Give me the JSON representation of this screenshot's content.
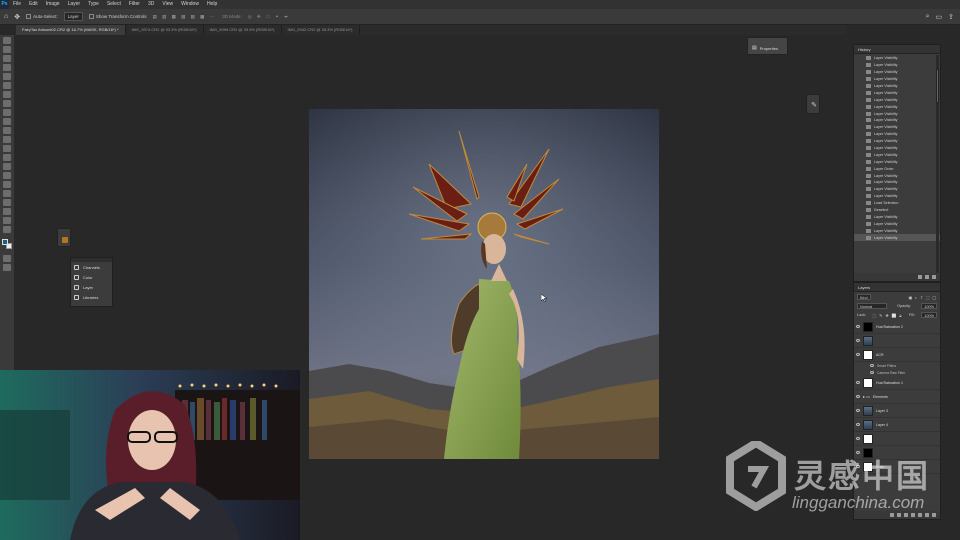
{
  "menubar": {
    "items": [
      "File",
      "Edit",
      "Image",
      "Layer",
      "Type",
      "Select",
      "Filter",
      "3D",
      "View",
      "Window",
      "Help"
    ]
  },
  "options": {
    "auto_select_label": "Auto-Select:",
    "auto_select_value": "Layer",
    "show_transform_label": "Show Transform Controls",
    "mode_3d_label": "3D Mode:"
  },
  "tabs": [
    {
      "label": "FairyTaz Artwork02.CR2 @ 16.7% (MASK, RGB/16*) *",
      "active": true
    },
    {
      "label": "IMG_9374.CR2 @ 33.3% (RGB/16*)",
      "active": false
    },
    {
      "label": "IMG_9399.CR2 @ 33.3% (RGB/16*)",
      "active": false
    },
    {
      "label": "IMG_9342.CR2 @ 33.3% (RGB/16*)",
      "active": false
    }
  ],
  "properties_panel": {
    "label": "Properties"
  },
  "stack_panel": {
    "items": [
      {
        "label": "Channels",
        "icon": "channels-icon"
      },
      {
        "label": "Color",
        "icon": "color-icon"
      },
      {
        "label": "Layer",
        "icon": "layer-icon"
      },
      {
        "label": "Libraries",
        "icon": "libraries-icon"
      }
    ]
  },
  "history": {
    "title": "History",
    "rows": [
      "Layer Visibility",
      "Layer Visibility",
      "Layer Visibility",
      "Layer Visibility",
      "Layer Visibility",
      "Layer Visibility",
      "Layer Visibility",
      "Layer Visibility",
      "Layer Visibility",
      "Layer Visibility",
      "Layer Visibility",
      "Layer Visibility",
      "Layer Visibility",
      "Layer Visibility",
      "Layer Visibility",
      "Layer Visibility",
      "Layer Order",
      "Layer Visibility",
      "Layer Visibility",
      "Layer Visibility",
      "Layer Visibility",
      "Load Selection",
      "Deselect",
      "Layer Visibility",
      "Layer Visibility",
      "Layer Visibility",
      "Layer Visibility"
    ],
    "current_index": 26
  },
  "layers": {
    "title": "Layers",
    "filter_label": "Kind",
    "blend_mode": "Normal",
    "opacity_label": "Opacity:",
    "opacity_value": "100%",
    "lock_label": "Lock:",
    "fill_label": "Fill:",
    "fill_value": "100%",
    "rows": [
      {
        "name": "Hue/Saturation 2",
        "thumb": "black",
        "kind": "layer"
      },
      {
        "name": "",
        "thumb": "photo",
        "kind": "layer"
      },
      {
        "name": "ACR",
        "thumb": "white",
        "kind": "layer"
      },
      {
        "name": "Smart Filters",
        "kind": "sub"
      },
      {
        "name": "Camera Raw Filter",
        "kind": "sub"
      },
      {
        "name": "Hue/Saturation 1",
        "thumb": "white",
        "kind": "layer"
      },
      {
        "name": "Elements",
        "kind": "group"
      },
      {
        "name": "Layer 3",
        "thumb": "photo",
        "kind": "layer"
      },
      {
        "name": "Layer 4",
        "thumb": "photo",
        "kind": "layer"
      },
      {
        "name": "",
        "thumb": "white",
        "kind": "layer"
      },
      {
        "name": "",
        "thumb": "black",
        "kind": "layer"
      },
      {
        "name": "Brian",
        "thumb": "white",
        "kind": "layer"
      }
    ]
  },
  "watermark": {
    "title": "灵感中国",
    "url": "lingganchina.com"
  },
  "colors": {
    "accent": "#31a8ff",
    "foreground": "#1f5f7a",
    "background": "#eeeeee"
  }
}
